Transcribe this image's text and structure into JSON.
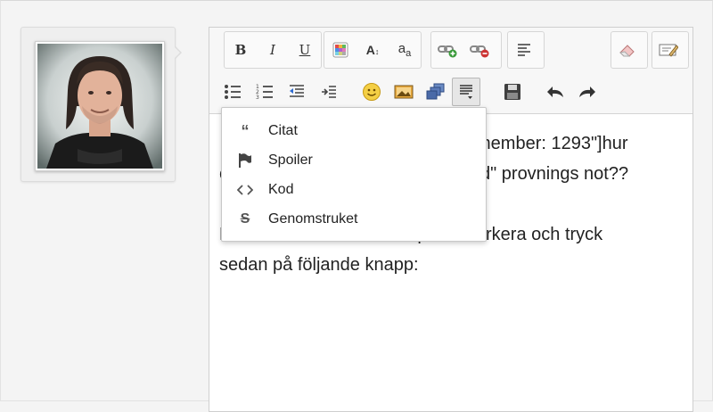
{
  "toolbar": {
    "row1": [
      {
        "name": "bold-button",
        "glyph": "B"
      },
      {
        "name": "italic-button",
        "glyph": "I"
      },
      {
        "name": "underline-button",
        "glyph": "U"
      },
      {
        "name": "color-button",
        "icon": "color-palette-icon"
      },
      {
        "name": "font-size-button",
        "glyph": "A↕"
      },
      {
        "name": "font-face-button",
        "glyph": "aα"
      },
      {
        "name": "insert-link-button",
        "icon": "link-add-icon"
      },
      {
        "name": "remove-link-button",
        "icon": "link-remove-icon"
      },
      {
        "name": "align-left-button",
        "icon": "align-left-icon"
      },
      {
        "name": "remove-format-button",
        "icon": "eraser-icon"
      },
      {
        "name": "toggle-source-button",
        "icon": "edit-source-icon"
      }
    ],
    "row2": [
      {
        "name": "bulleted-list-button",
        "icon": "bulleted-list-icon"
      },
      {
        "name": "numbered-list-button",
        "icon": "numbered-list-icon"
      },
      {
        "name": "outdent-button",
        "icon": "outdent-icon"
      },
      {
        "name": "indent-button",
        "icon": "indent-icon"
      },
      {
        "name": "emoticon-button",
        "icon": "smiley-icon"
      },
      {
        "name": "insert-image-button",
        "icon": "image-icon"
      },
      {
        "name": "insert-media-button",
        "icon": "media-icon"
      },
      {
        "name": "insert-block-button",
        "icon": "block-format-icon"
      },
      {
        "name": "save-button",
        "icon": "floppy-disk-icon"
      },
      {
        "name": "undo-button",
        "icon": "undo-icon"
      },
      {
        "name": "redo-button",
        "icon": "redo-icon"
      }
    ]
  },
  "dropdown": {
    "items": [
      {
        "label": "Citat",
        "icon": "quote-icon"
      },
      {
        "label": "Spoiler",
        "icon": "flag-icon"
      },
      {
        "label": "Kod",
        "icon": "code-icon"
      },
      {
        "label": "Genomstruket",
        "icon": "strikethrough-icon"
      }
    ]
  },
  "content": {
    "line1_visible": "member: 1293\"]hur",
    "line2_left": "c",
    "line2_visible": "d\" provnings not??",
    "line3": "Markera den text du vill spoilermarkera och tryck",
    "line4": "sedan på följande knapp:"
  },
  "colors": {
    "accent_green": "#3a9a3a",
    "accent_red": "#cc3333",
    "text": "#222222"
  }
}
